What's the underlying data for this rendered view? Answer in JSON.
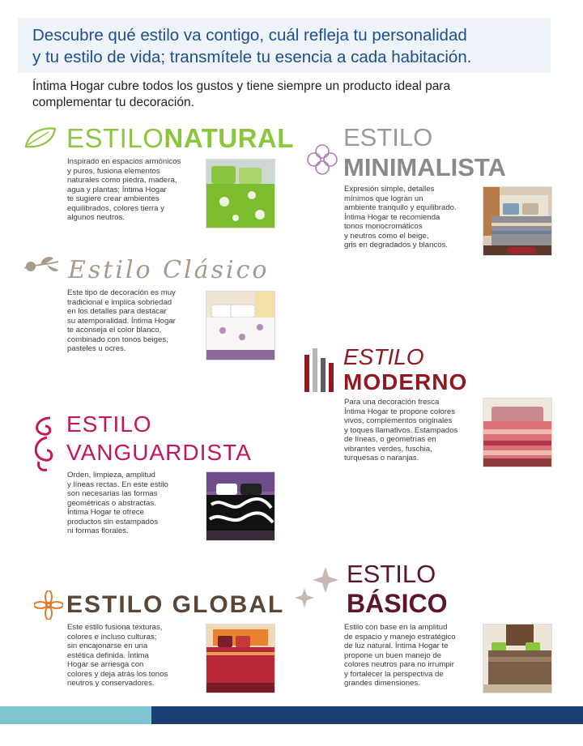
{
  "banner": {
    "line1": "Descubre qué estilo va contigo, cuál refleja tu personalidad",
    "line2": "y tu estilo de vida; transmítele tu esencia a cada habitación."
  },
  "intro": {
    "line1": "Íntima Hogar cubre todos los gustos y tiene siempre un producto ideal para",
    "line2": "complementar tu decoración."
  },
  "styles": {
    "natural": {
      "title_a": "ESTILO",
      "title_b": "NATURAL",
      "text": "Inspirado en espacios armónicos\ny puros, fusiona elementos\nnaturales como piedra, madera,\nagua y plantas; Íntima Hogar\nte sugiere crear ambientes\nequilibrados, colores tierra y\nalgunos neutros."
    },
    "minimalista": {
      "title_a": "ESTILO",
      "title_b": "MINIMALISTA",
      "text": "Expresión simple, detalles\nmínimos que logran un\nambiente tranquilo y equilibrado.\nÍntima Hogar te recomienda\ntonos monocromáticos\ny neutros como el beige,\ngris en degradados y blancos."
    },
    "clasico": {
      "title_a": "Estilo Clásico",
      "text": "Este tipo de decoración es muy\ntradicional e implica sobriedad\nen los detalles para destacar\nsu atemporalidad. Íntima Hogar\nte aconseja el color blanco,\ncombinado con tonos beiges,\npasteles u ocres."
    },
    "moderno": {
      "title_a": "ESTILO",
      "title_b": "MODERNO",
      "text": "Para una decoración fresca\nÍntima Hogar te propone colores\nvivos, complementos originales\ny toques llamativos. Estampados\nde líneas, o geometrías en\nvibrantes verdes, fuschia,\nturquesas o naranjas."
    },
    "vanguardista": {
      "title_a": "ESTILO",
      "title_b": "VANGUARDISTA",
      "text": "Orden, limpieza, amplitud\ny líneas rectas. En este estilo\nson necesarias las formas\ngeométricas o abstractas.\nÍntima Hogar te ofrece\nproductos sin estampados\nni formas florales."
    },
    "global": {
      "title_a": "ESTILO GLOBAL",
      "text": "Este estilo fusiona texturas,\ncolores e incluso culturas;\nsin encajonarse en una\nestética definida. Íntima\nHogar se arriesga con\ncolores y deja atrás los tonos\nneutros y conservadores."
    },
    "basico": {
      "title_a": "ESTILO",
      "title_b": "BÁSICO",
      "text": "Estilo con base en la amplitud\nde espacio y manejo estratégico\nde luz natural. Íntima Hogar te\npropone un buen manejo de\ncolores neutros para no irrumpir\ny fortalecer la perspectiva de\ngrandes dimensiones."
    }
  },
  "colors": {
    "banner_text": "#1f4e8c",
    "natural": "#8cc63f",
    "minimalista": "#9a9a9c",
    "clasico": "#a89a8a",
    "moderno": "#8e1b24",
    "vanguardista": "#c2185b",
    "global": "#5a4637",
    "basico": "#5b1628",
    "footer_light": "#7fc3d0",
    "footer_dark": "#1b3f73"
  },
  "icons": [
    "leaf-icon",
    "flower-rings-icon",
    "rose-branch-icon",
    "bars-icon",
    "swirl-icon",
    "flower-icon",
    "stars-icon"
  ]
}
